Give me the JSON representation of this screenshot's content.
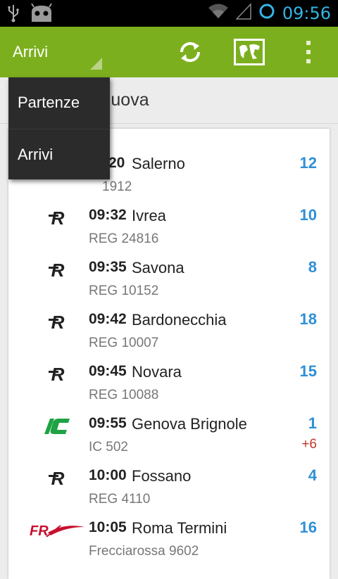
{
  "statusbar": {
    "clock": "09:56"
  },
  "actionbar": {
    "spinner_label": "Arrivi"
  },
  "dropdown": {
    "items": [
      {
        "label": "Partenze"
      },
      {
        "label": "Arrivi"
      }
    ]
  },
  "station": {
    "name_visible": "rino Porta Nuova"
  },
  "trains": [
    {
      "time": "09:20",
      "time_visible": "20",
      "destination": "Salerno",
      "train": "IC 1912",
      "train_visible": "1912",
      "platform": "12",
      "logo": "ic"
    },
    {
      "time": "09:32",
      "destination": "Ivrea",
      "train": "REG 24816",
      "platform": "10",
      "logo": "regionale"
    },
    {
      "time": "09:35",
      "destination": "Savona",
      "train": "REG 10152",
      "platform": "8",
      "logo": "regionale"
    },
    {
      "time": "09:42",
      "destination": "Bardonecchia",
      "train": "REG 10007",
      "platform": "18",
      "logo": "regionale"
    },
    {
      "time": "09:45",
      "destination": "Novara",
      "train": "REG 10088",
      "platform": "15",
      "logo": "regionale"
    },
    {
      "time": "09:55",
      "destination": "Genova Brignole",
      "train": "IC 502",
      "platform": "1",
      "delay": "+6",
      "logo": "ic"
    },
    {
      "time": "10:00",
      "destination": "Fossano",
      "train": "REG 4110",
      "platform": "4",
      "logo": "regionale"
    },
    {
      "time": "10:05",
      "destination": "Roma Termini",
      "train": "Frecciarossa 9602",
      "platform": "16",
      "logo": "frecciarossa"
    }
  ],
  "colors": {
    "actionbar": "#7caf1e",
    "platform": "#2e8fd6",
    "delay": "#c0392b",
    "ic_logo": "#1fa344",
    "fr_logo": "#c8102e"
  },
  "icons": [
    "usb-icon",
    "android-icon",
    "wifi-icon",
    "signal-icon",
    "sync-icon",
    "refresh-icon",
    "map-icon",
    "overflow-menu-icon"
  ]
}
